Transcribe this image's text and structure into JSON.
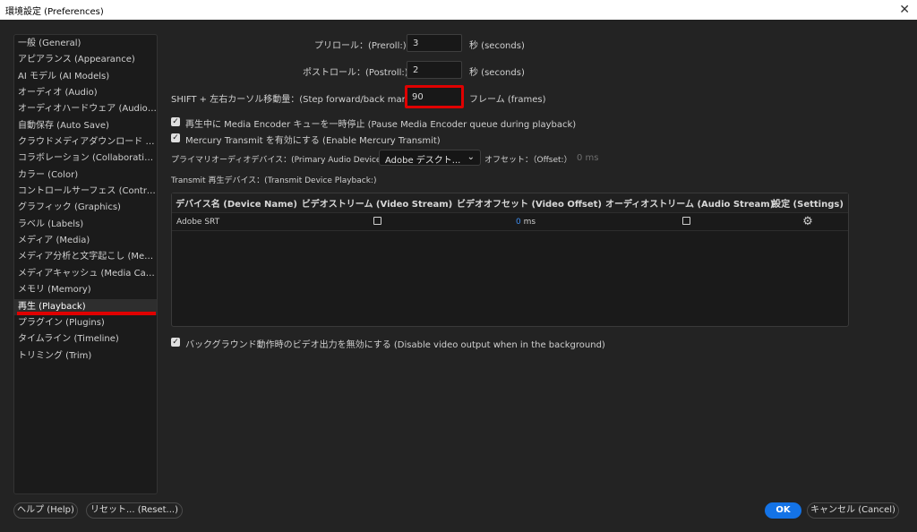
{
  "window": {
    "title": "環境設定 (Preferences)",
    "close_glyph": "✕"
  },
  "sidebar": {
    "items": [
      {
        "label": "一般 (General)",
        "selected": false
      },
      {
        "label": "アピアランス (Appearance)",
        "selected": false
      },
      {
        "label": "AI モデル (AI Models)",
        "selected": false
      },
      {
        "label": "オーディオ (Audio)",
        "selected": false
      },
      {
        "label": "オーディオハードウェア (Audio Hardware)",
        "selected": false
      },
      {
        "label": "自動保存 (Auto Save)",
        "selected": false
      },
      {
        "label": "クラウドメディアダウンロード (Cloud Media Download)",
        "selected": false
      },
      {
        "label": "コラボレーション (Collaboration)",
        "selected": false
      },
      {
        "label": "カラー (Color)",
        "selected": false
      },
      {
        "label": "コントロールサーフェス (Control Surface)",
        "selected": false
      },
      {
        "label": "グラフィック (Graphics)",
        "selected": false
      },
      {
        "label": "ラベル (Labels)",
        "selected": false
      },
      {
        "label": "メディア (Media)",
        "selected": false
      },
      {
        "label": "メディア分析と文字起こし (Media Intelligence)",
        "selected": false
      },
      {
        "label": "メディアキャッシュ (Media Cache)",
        "selected": false
      },
      {
        "label": "メモリ (Memory)",
        "selected": false
      },
      {
        "label": "再生 (Playback)",
        "selected": true
      },
      {
        "label": "プラグイン (Plugins)",
        "selected": false
      },
      {
        "label": "タイムライン (Timeline)",
        "selected": false
      },
      {
        "label": "トリミング (Trim)",
        "selected": false
      }
    ]
  },
  "playback": {
    "preroll_label": "プリロール：(Preroll:)",
    "preroll_value": "3",
    "preroll_unit": "秒 (seconds)",
    "postroll_label": "ポストロール：(Postroll:)",
    "postroll_value": "2",
    "postroll_unit": "秒 (seconds)",
    "step_label": "SHIFT + 左右カーソル移動量：(Step forward/back many:)",
    "step_value": "90",
    "step_unit": "フレーム (frames)",
    "pause_encoder_label": "再生中に Media Encoder キューを一時停止 (Pause Media Encoder queue during playback)",
    "pause_encoder_checked": true,
    "mercury_label": "Mercury Transmit を有効にする (Enable Mercury Transmit)",
    "mercury_checked": true,
    "primary_audio_label": "プライマリオーディオデバイス：(Primary Audio Device:)",
    "primary_audio_value": "Adobe デスクト...",
    "offset_label": "オフセット：（Offset:）",
    "offset_value": "0 ms",
    "transmit_devices_label": "Transmit 再生デバイス：(Transmit Device Playback:)",
    "disable_bg_label": "バックグラウンド動作時のビデオ出力を無効にする (Disable video output when in the background)",
    "disable_bg_checked": true
  },
  "device_table": {
    "headers": [
      "デバイス名 (Device Name)",
      "ビデオストリーム (Video Stream)",
      "ビデオオフセット (Video Offset)",
      "オーディオストリーム (Audio Stream)",
      "設定 (Settings)"
    ],
    "rows": [
      {
        "name": "Adobe SRT",
        "video_offset_value": "0",
        "video_offset_unit": "ms"
      }
    ]
  },
  "footer": {
    "help_label": "ヘルプ (Help)",
    "reset_label": "リセット... (Reset...)",
    "ok_label": "OK",
    "cancel_label": "キャンセル (Cancel)"
  },
  "colors": {
    "accent": "#1473e6",
    "highlight": "#e00000",
    "background": "#232323"
  },
  "icons": {
    "settings": "gear-icon",
    "close": "close-icon",
    "dropdown": "chevron-down-icon"
  }
}
